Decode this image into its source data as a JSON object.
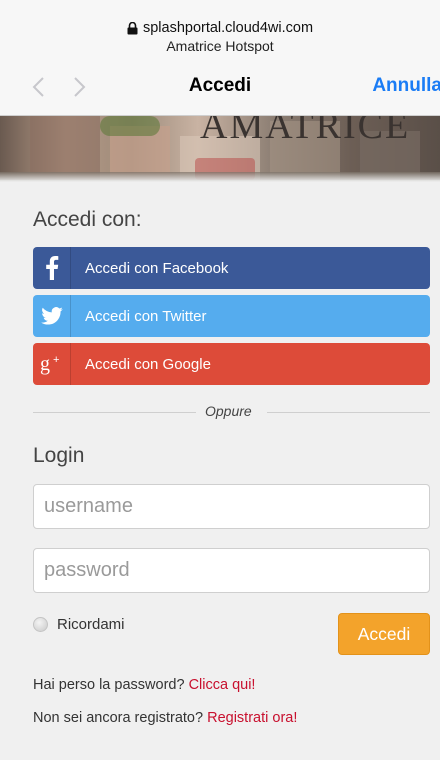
{
  "browser": {
    "url": "splashportal.cloud4wi.com",
    "subtitle": "Amatrice Hotspot",
    "title": "Accedi",
    "cancel_label": "Annulla",
    "back_icon": "chevron-left-icon",
    "forward_icon": "chevron-right-icon",
    "lock_icon": "lock-icon"
  },
  "banner": {
    "logo_text": "AMATRICE"
  },
  "social": {
    "heading": "Accedi con:",
    "buttons": [
      {
        "label": "Accedi con Facebook",
        "icon": "facebook-icon",
        "color": "#3b5998"
      },
      {
        "label": "Accedi con Twitter",
        "icon": "twitter-icon",
        "color": "#55acee"
      },
      {
        "label": "Accedi con Google",
        "icon": "google-plus-icon",
        "color": "#dd4b39"
      }
    ]
  },
  "divider": {
    "text": "Oppure"
  },
  "login": {
    "heading": "Login",
    "username_placeholder": "username",
    "username_value": "",
    "password_placeholder": "password",
    "password_value": "",
    "remember_label": "Ricordami",
    "remember_checked": false,
    "submit_label": "Accedi",
    "submit_color": "#f3a32b"
  },
  "help": {
    "forgot_text": "Hai perso la password?",
    "forgot_link": "Clicca qui!",
    "register_text": "Non sei ancora registrato?",
    "register_link": "Registrati ora!",
    "link_color": "#c8102e"
  },
  "accent": "#1a7cf5"
}
